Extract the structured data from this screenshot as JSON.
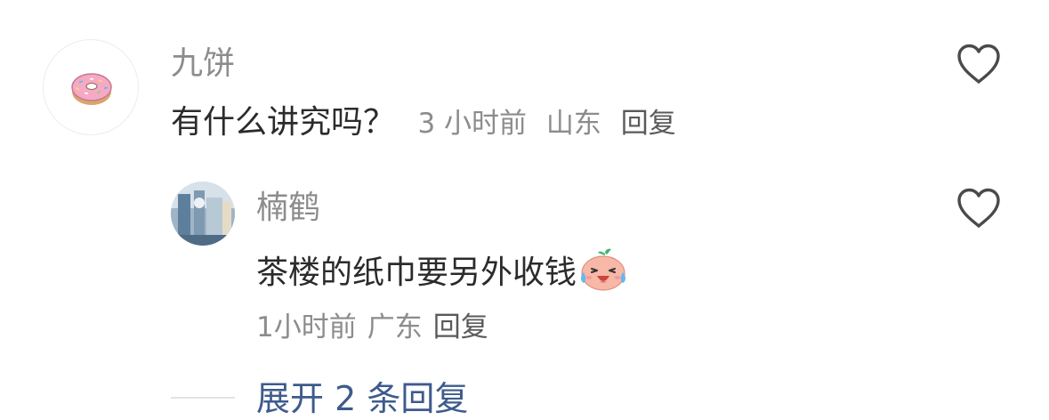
{
  "comment": {
    "username": "九饼",
    "text": "有什么讲究吗？",
    "time": "3 小时前",
    "location": "山东",
    "reply_label": "回复",
    "avatar_icon": "donut-icon",
    "like_icon": "heart-outline-icon"
  },
  "reply": {
    "username": "楠鹤",
    "text": "茶楼的纸巾要另外收钱",
    "emoji_icon": "laughing-crying-face-icon",
    "time": "1小时前",
    "location": "广东",
    "reply_label": "回复",
    "like_icon": "heart-outline-icon"
  },
  "expand_replies": {
    "label": "展开 2 条回复"
  },
  "colors": {
    "username": "#8c8c8c",
    "body_text": "#2b2b2b",
    "link": "#3d5b8c"
  }
}
